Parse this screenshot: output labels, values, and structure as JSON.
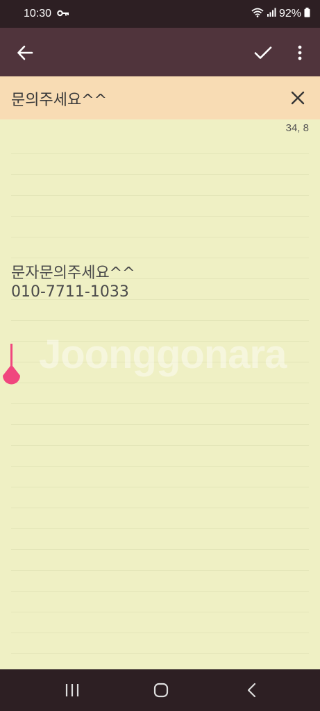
{
  "status_bar": {
    "time": "10:30",
    "battery": "92%",
    "icons": [
      "key-icon",
      "wifi-icon",
      "signal-icon",
      "battery-icon"
    ]
  },
  "app_bar": {
    "background": "#50343c",
    "icons": [
      "back-arrow-icon",
      "check-icon",
      "more-vert-icon"
    ]
  },
  "title_bar": {
    "title": "문의주세요^^",
    "background": "#f8dcb4"
  },
  "note": {
    "cursor_position": "34, 8",
    "lines": [
      "문자문의주세요^^",
      "010-7711-1033"
    ],
    "watermark": "Joonggonara",
    "background": "#eff0c4",
    "caret_color": "#f0467e"
  },
  "nav_bar": {
    "icons": [
      "recent-apps-icon",
      "home-icon",
      "nav-back-icon"
    ]
  }
}
